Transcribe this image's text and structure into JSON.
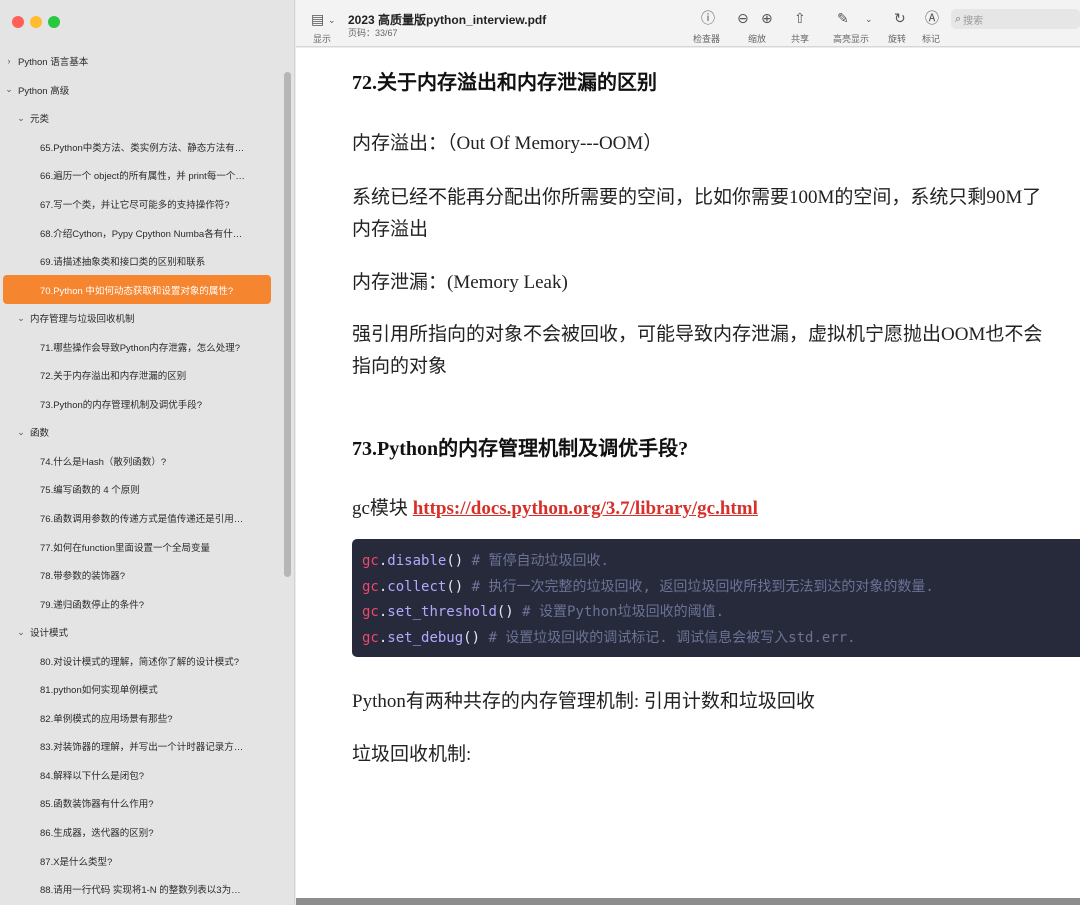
{
  "window": {
    "title": "2023 高质量版python_interview.pdf",
    "page_indicator": "页码：33/67"
  },
  "toolbar": {
    "sidebar_toggle_label": "显示",
    "inspector_label": "检查器",
    "zoom_label": "缩放",
    "share_label": "共享",
    "highlight_label": "高亮显示",
    "rotate_label": "旋转",
    "markup_label": "标记",
    "search_placeholder": "搜索"
  },
  "sidebar": {
    "items": [
      {
        "label": "Python 语言基本",
        "level": 0,
        "collapsed": true
      },
      {
        "label": "Python 高级",
        "level": 0,
        "collapsed": false
      },
      {
        "label": "元类",
        "level": 1,
        "collapsed": false
      },
      {
        "label": "65.Python中类方法、类实例方法、静态方法有…",
        "level": 2
      },
      {
        "label": "66.遍历一个 object的所有属性，并 print每一个…",
        "level": 2
      },
      {
        "label": "67.写一个类，并让它尽可能多的支持操作符?",
        "level": 2
      },
      {
        "label": "68.介绍Cython，Pypy Cpython Numba各有什…",
        "level": 2
      },
      {
        "label": "69.请描述抽象类和接口类的区别和联系",
        "level": 2
      },
      {
        "label": "70.Python 中如何动态获取和设置对象的属性?",
        "level": 2,
        "selected": true
      },
      {
        "label": "内存管理与垃圾回收机制",
        "level": 1,
        "collapsed": false
      },
      {
        "label": "71.哪些操作会导致Python内存泄露，怎么处理?",
        "level": 2
      },
      {
        "label": "72.关于内存溢出和内存泄漏的区别",
        "level": 2
      },
      {
        "label": "73.Python的内存管理机制及调优手段?",
        "level": 2
      },
      {
        "label": "函数",
        "level": 1,
        "collapsed": false
      },
      {
        "label": "74.什么是Hash（散列函数）?",
        "level": 2
      },
      {
        "label": "75.编写函数的 4 个原则",
        "level": 2
      },
      {
        "label": "76.函数调用参数的传递方式是值传递还是引用…",
        "level": 2
      },
      {
        "label": "77.如何在function里面设置一个全局变量",
        "level": 2
      },
      {
        "label": "78.带参数的装饰器?",
        "level": 2
      },
      {
        "label": "79.递归函数停止的条件?",
        "level": 2
      },
      {
        "label": "设计模式",
        "level": 1,
        "collapsed": false
      },
      {
        "label": "80.对设计模式的理解，简述你了解的设计模式?",
        "level": 2
      },
      {
        "label": "81.python如何实现单例模式",
        "level": 2
      },
      {
        "label": "82.单例模式的应用场景有那些?",
        "level": 2
      },
      {
        "label": "83.对装饰器的理解，并写出一个计时器记录方…",
        "level": 2
      },
      {
        "label": "84.解释以下什么是闭包?",
        "level": 2
      },
      {
        "label": "85.函数装饰器有什么作用?",
        "level": 2
      },
      {
        "label": "86.生成器，迭代器的区别?",
        "level": 2
      },
      {
        "label": "87.X是什么类型?",
        "level": 2
      },
      {
        "label": "88.请用一行代码 实现将1-N 的整数列表以3为…",
        "level": 2
      }
    ]
  },
  "document": {
    "heading72": "72.关于内存溢出和内存泄漏的区别",
    "oom_line": "内存溢出：（Out Of Memory---OOM）",
    "oom_desc_1": "系统已经不能再分配出你所需要的空间，比如你需要100M的空间，系统只剩90M了",
    "oom_desc_2": "内存溢出",
    "leak_line": "内存泄漏：(Memory Leak)",
    "leak_desc_1": "强引用所指向的对象不会被回收，可能导致内存泄漏，虚拟机宁愿抛出OOM也不会",
    "leak_desc_2": "指向的对象",
    "heading73": "73.Python的内存管理机制及调优手段?",
    "gc_prefix": "gc模块 ",
    "gc_link": "https://docs.python.org/3.7/library/gc.html",
    "code": [
      {
        "obj": "gc",
        "dot": ".",
        "fn": "disable",
        "paren": "()",
        "comment": "  # 暂停自动垃圾回收."
      },
      {
        "obj": "gc",
        "dot": ".",
        "fn": "collect",
        "paren": "()",
        "comment": "  # 执行一次完整的垃圾回收, 返回垃圾回收所找到无法到达的对象的数量."
      },
      {
        "obj": "gc",
        "dot": ".",
        "fn": "set_threshold",
        "paren": "()",
        "comment": "  # 设置Python垃圾回收的阈值."
      },
      {
        "obj": "gc",
        "dot": ".",
        "fn": "set_debug",
        "paren": "()",
        "comment": "  # 设置垃圾回收的调试标记. 调试信息会被写入std.err."
      }
    ],
    "mechanism_line": "Python有两种共存的内存管理机制: 引用计数和垃圾回收",
    "gc_mechanism_label": "垃圾回收机制:"
  }
}
